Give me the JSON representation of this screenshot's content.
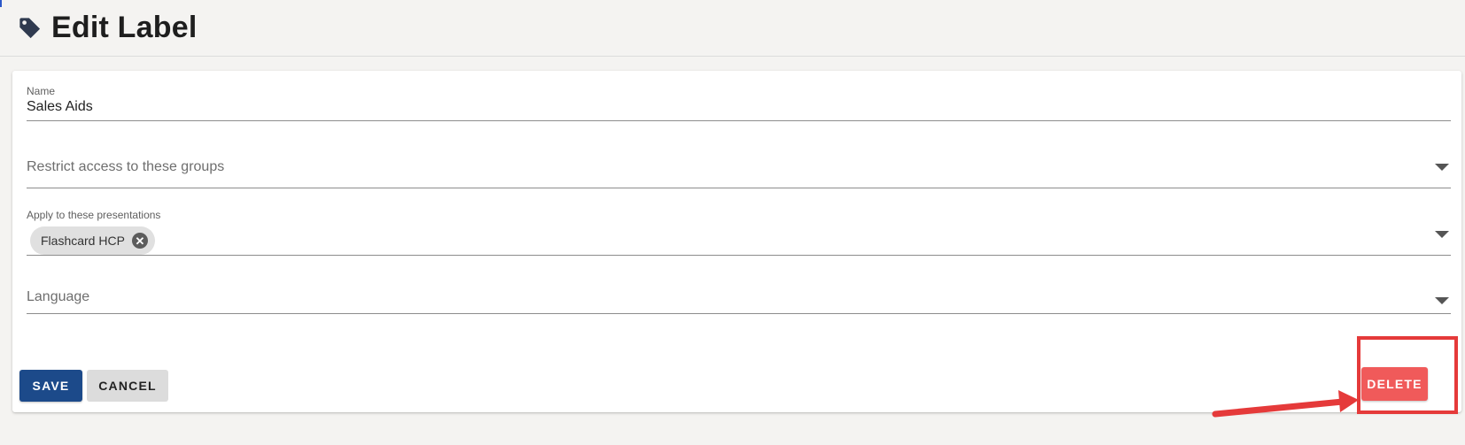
{
  "header": {
    "title": "Edit Label",
    "icon": "tag-icon"
  },
  "form": {
    "name": {
      "label": "Name",
      "value": "Sales Aids"
    },
    "groups": {
      "placeholder": "Restrict access to these groups"
    },
    "presentations": {
      "label": "Apply to these presentations",
      "chips": [
        "Flashcard HCP"
      ]
    },
    "language": {
      "placeholder": "Language"
    }
  },
  "actions": {
    "save_label": "SAVE",
    "cancel_label": "CANCEL",
    "delete_label": "DELETE"
  },
  "colors": {
    "primary": "#1c4a8a",
    "danger": "#f05a5a",
    "annotation": "#e53a3a"
  }
}
